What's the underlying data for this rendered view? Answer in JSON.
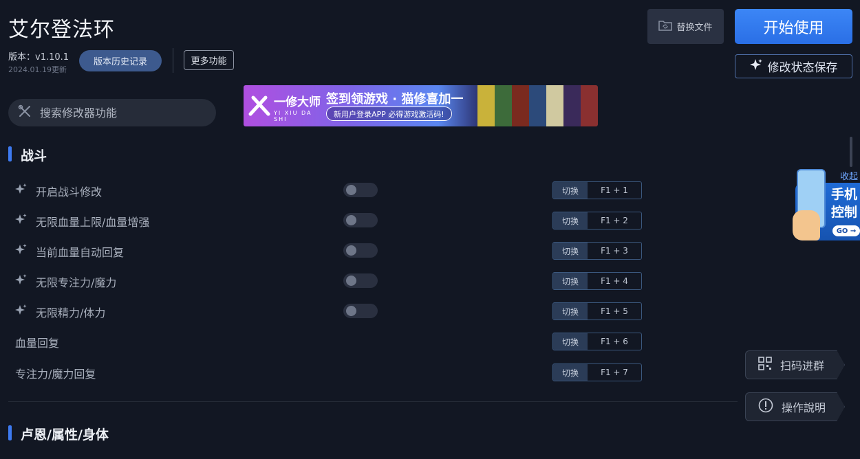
{
  "header": {
    "title": "艾尔登法环",
    "version": "版本：v1.10.1",
    "date": "2024.01.19更新",
    "history_label": "版本历史记录",
    "more_label": "更多功能",
    "replace_label": "替换文件",
    "start_label": "开始使用",
    "save_label": "修改状态保存"
  },
  "search": {
    "placeholder": "搜索修改器功能"
  },
  "banner": {
    "logo_title": "一修大师",
    "logo_sub": "YI XIU DA SHI",
    "headline": "签到领游戏 · 猫修喜加一",
    "pill": "新用户登录APP  必得游戏激活码!"
  },
  "sections": [
    {
      "title": "战斗",
      "rows": [
        {
          "label": "开启战斗修改",
          "has_toggle": true,
          "hotkey_tag": "切换",
          "hotkey": "F1 + 1"
        },
        {
          "label": "无限血量上限/血量增强",
          "has_toggle": true,
          "hotkey_tag": "切换",
          "hotkey": "F1 + 2"
        },
        {
          "label": "当前血量自动回复",
          "has_toggle": true,
          "hotkey_tag": "切换",
          "hotkey": "F1 + 3"
        },
        {
          "label": "无限专注力/魔力",
          "has_toggle": true,
          "hotkey_tag": "切换",
          "hotkey": "F1 + 4"
        },
        {
          "label": "无限精力/体力",
          "has_toggle": true,
          "hotkey_tag": "切换",
          "hotkey": "F1 + 5"
        },
        {
          "label": "血量回复",
          "has_toggle": false,
          "hotkey_tag": "切换",
          "hotkey": "F1 + 6"
        },
        {
          "label": "专注力/魔力回复",
          "has_toggle": false,
          "hotkey_tag": "切换",
          "hotkey": "F1 + 7"
        }
      ]
    },
    {
      "title": "卢恩/属性/身体"
    }
  ],
  "side": {
    "collapse": "收起",
    "phone_text": "手机控制",
    "go": "GO →",
    "qr_label": "扫码进群",
    "help_label": "操作說明"
  },
  "colors": {
    "accent": "#3d7af0",
    "background": "#121723"
  }
}
